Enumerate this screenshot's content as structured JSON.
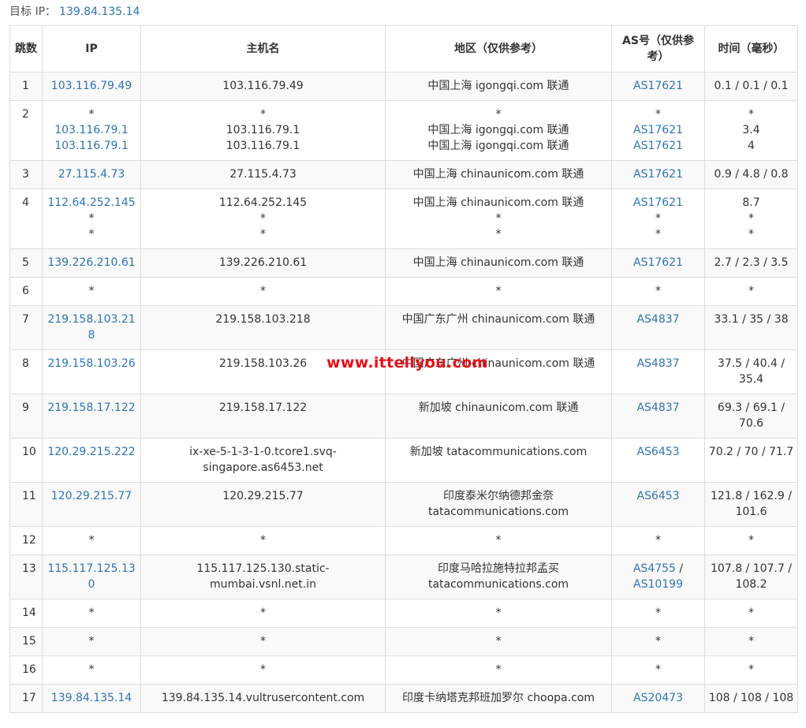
{
  "target": {
    "label": "目标 IP：",
    "ip": "139.84.135.14"
  },
  "table": {
    "headers": {
      "hop": "跳数",
      "ip": "IP",
      "host": "主机名",
      "region": "地区（仅供参考）",
      "asn": "AS号（仅供参考）",
      "time": "时间（毫秒）"
    },
    "rows": [
      {
        "hop": "1",
        "ip": [
          "103.116.79.49"
        ],
        "host": [
          "103.116.79.49"
        ],
        "region": [
          "中国上海 igongqi.com 联通"
        ],
        "asn": [
          "AS17621"
        ],
        "time": "0.1 / 0.1 / 0.1"
      },
      {
        "hop": "2",
        "ip": [
          "*",
          "103.116.79.1",
          "103.116.79.1"
        ],
        "host": [
          "*",
          "103.116.79.1",
          "103.116.79.1"
        ],
        "region": [
          "*",
          "中国上海 igongqi.com 联通",
          "中国上海 igongqi.com 联通"
        ],
        "asn": [
          "*",
          "AS17621",
          "AS17621"
        ],
        "time": "* 3.4 4"
      },
      {
        "hop": "3",
        "ip": [
          "27.115.4.73"
        ],
        "host": [
          "27.115.4.73"
        ],
        "region": [
          "中国上海 chinaunicom.com 联通"
        ],
        "asn": [
          "AS17621"
        ],
        "time": "0.9 / 4.8 / 0.8"
      },
      {
        "hop": "4",
        "ip": [
          "112.64.252.145",
          "*",
          "*"
        ],
        "host": [
          "112.64.252.145",
          "*",
          "*"
        ],
        "region": [
          "中国上海 chinaunicom.com 联通",
          "*",
          "*"
        ],
        "asn": [
          "AS17621",
          "*",
          "*"
        ],
        "time": "8.7 * *"
      },
      {
        "hop": "5",
        "ip": [
          "139.226.210.61"
        ],
        "host": [
          "139.226.210.61"
        ],
        "region": [
          "中国上海 chinaunicom.com 联通"
        ],
        "asn": [
          "AS17621"
        ],
        "time": "2.7 / 2.3 / 3.5"
      },
      {
        "hop": "6",
        "ip": [
          "*"
        ],
        "host": [
          "*"
        ],
        "region": [
          "*"
        ],
        "asn": [
          "*"
        ],
        "time": "*"
      },
      {
        "hop": "7",
        "ip": [
          "219.158.103.218"
        ],
        "host": [
          "219.158.103.218"
        ],
        "region": [
          "中国广东广州 chinaunicom.com 联通"
        ],
        "asn": [
          "AS4837"
        ],
        "time": "33.1 / 35 / 38"
      },
      {
        "hop": "8",
        "ip": [
          "219.158.103.26"
        ],
        "host": [
          "219.158.103.26"
        ],
        "region": [
          "中国广东广州 chinaunicom.com 联通"
        ],
        "asn": [
          "AS4837"
        ],
        "time": "37.5 / 40.4 / 35.4"
      },
      {
        "hop": "9",
        "ip": [
          "219.158.17.122"
        ],
        "host": [
          "219.158.17.122"
        ],
        "region": [
          "新加坡 chinaunicom.com 联通"
        ],
        "asn": [
          "AS4837"
        ],
        "time": "69.3 / 69.1 / 70.6"
      },
      {
        "hop": "10",
        "ip": [
          "120.29.215.222"
        ],
        "host": [
          "ix-xe-5-1-3-1-0.tcore1.svq-singapore.as6453.net"
        ],
        "region": [
          "新加坡 tatacommunications.com"
        ],
        "asn": [
          "AS6453"
        ],
        "time": "70.2 / 70 / 71.7"
      },
      {
        "hop": "11",
        "ip": [
          "120.29.215.77"
        ],
        "host": [
          "120.29.215.77"
        ],
        "region": [
          "印度泰米尔纳德邦金奈 tatacommunications.com"
        ],
        "asn": [
          "AS6453"
        ],
        "time": "121.8 / 162.9 / 101.6"
      },
      {
        "hop": "12",
        "ip": [
          "*"
        ],
        "host": [
          "*"
        ],
        "region": [
          "*"
        ],
        "asn": [
          "*"
        ],
        "time": "*"
      },
      {
        "hop": "13",
        "ip": [
          "115.117.125.130"
        ],
        "host": [
          "115.117.125.130.static-mumbai.vsnl.net.in"
        ],
        "region": [
          "印度马哈拉施特拉邦孟买 tatacommunications.com"
        ],
        "asn": [
          "AS4755",
          "AS10199"
        ],
        "time": "107.8 / 107.7 / 108.2"
      },
      {
        "hop": "14",
        "ip": [
          "*"
        ],
        "host": [
          "*"
        ],
        "region": [
          "*"
        ],
        "asn": [
          "*"
        ],
        "time": "*"
      },
      {
        "hop": "15",
        "ip": [
          "*"
        ],
        "host": [
          "*"
        ],
        "region": [
          "*"
        ],
        "asn": [
          "*"
        ],
        "time": "*"
      },
      {
        "hop": "16",
        "ip": [
          "*"
        ],
        "host": [
          "*"
        ],
        "region": [
          "*"
        ],
        "asn": [
          "*"
        ],
        "time": "*"
      },
      {
        "hop": "17",
        "ip": [
          "139.84.135.14"
        ],
        "host": [
          "139.84.135.14.vultrusercontent.com"
        ],
        "region": [
          "印度卡纳塔克邦班加罗尔 choopa.com"
        ],
        "asn": [
          "AS20473"
        ],
        "time": "108 / 108 / 108"
      }
    ]
  },
  "watermark": "www.ittellyou.com",
  "colors": {
    "link": "#2f74b5",
    "watermark": "#e8101a",
    "border": "#dddddd",
    "stripe": "#f9f9f9"
  }
}
